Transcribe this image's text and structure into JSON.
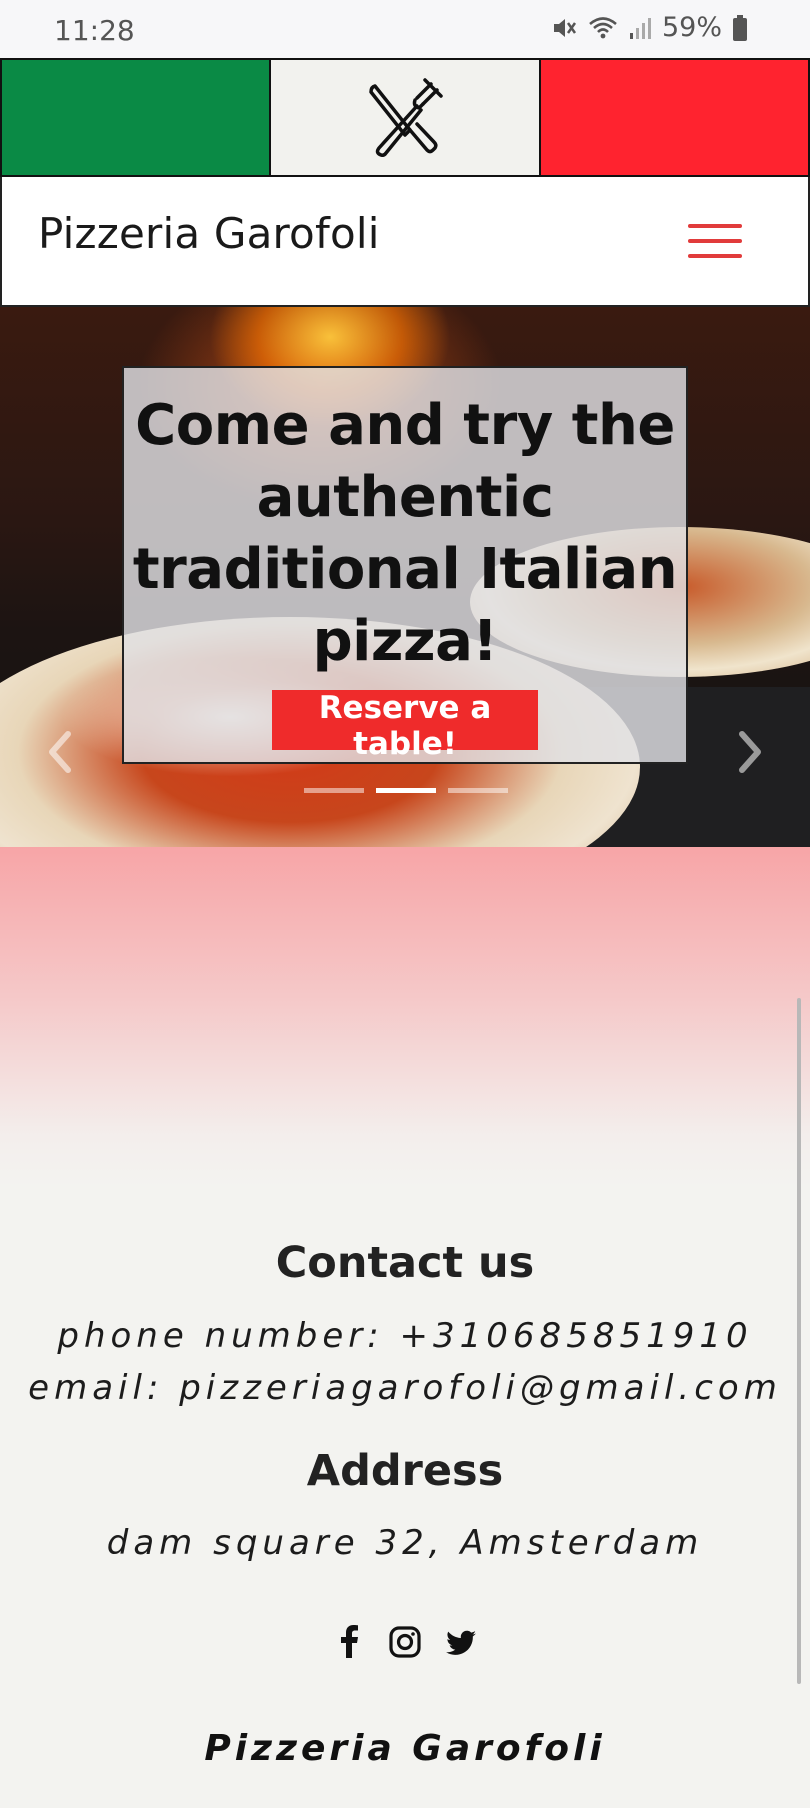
{
  "status_bar": {
    "time": "11:28",
    "battery": "59%",
    "icons": [
      "mute-icon",
      "wifi-icon",
      "signal-icon",
      "battery-icon"
    ]
  },
  "flag": {
    "colors": [
      "#0a8a45",
      "#f2f2ee",
      "#ff232f"
    ],
    "center_icon": "fork-knife-icon"
  },
  "navbar": {
    "brand": "Pizzeria Garofoli",
    "menu_icon": "hamburger-menu-icon",
    "accent": "#e13b3b"
  },
  "hero": {
    "title": "Come and try the authentic traditional Italian pizza!",
    "button_label": "Reserve a table!",
    "button_color": "#ef2b2b",
    "slides": 3,
    "active_slide": 2
  },
  "contact": {
    "title": "Contact us",
    "phone": "phone number: +310685851910",
    "email": "email: pizzeriagarofoli@gmail.com"
  },
  "address": {
    "title": "Address",
    "value": "dam square 32, Amsterdam"
  },
  "socials": [
    "facebook-icon",
    "instagram-icon",
    "twitter-icon"
  ],
  "footer": {
    "brand": "Pizzeria Garofoli"
  }
}
